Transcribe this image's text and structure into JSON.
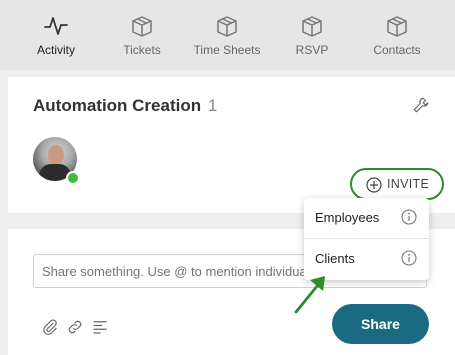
{
  "nav": {
    "tabs": [
      {
        "label": "Activity",
        "icon": "activity-icon",
        "active": true
      },
      {
        "label": "Tickets",
        "icon": "box-icon"
      },
      {
        "label": "Time Sheets",
        "icon": "box-icon"
      },
      {
        "label": "RSVP",
        "icon": "box-icon"
      },
      {
        "label": "Contacts",
        "icon": "box-icon"
      }
    ]
  },
  "group": {
    "title": "Automation Creation",
    "member_count": "1",
    "settings_icon": "wrench-icon",
    "invite_label": "INVITE",
    "invite_icon": "plus-circle-icon",
    "online_color": "#3dbb3d",
    "highlight_color": "#2d8c2d"
  },
  "invite_menu": {
    "items": [
      {
        "label": "Employees",
        "icon": "info-icon"
      },
      {
        "label": "Clients",
        "icon": "info-icon"
      }
    ]
  },
  "composer": {
    "placeholder": "Share something. Use @ to mention individuals",
    "tools": [
      "attachment-icon",
      "link-icon",
      "text-format-icon"
    ],
    "share_label": "Share",
    "share_color": "#1a6b82"
  }
}
